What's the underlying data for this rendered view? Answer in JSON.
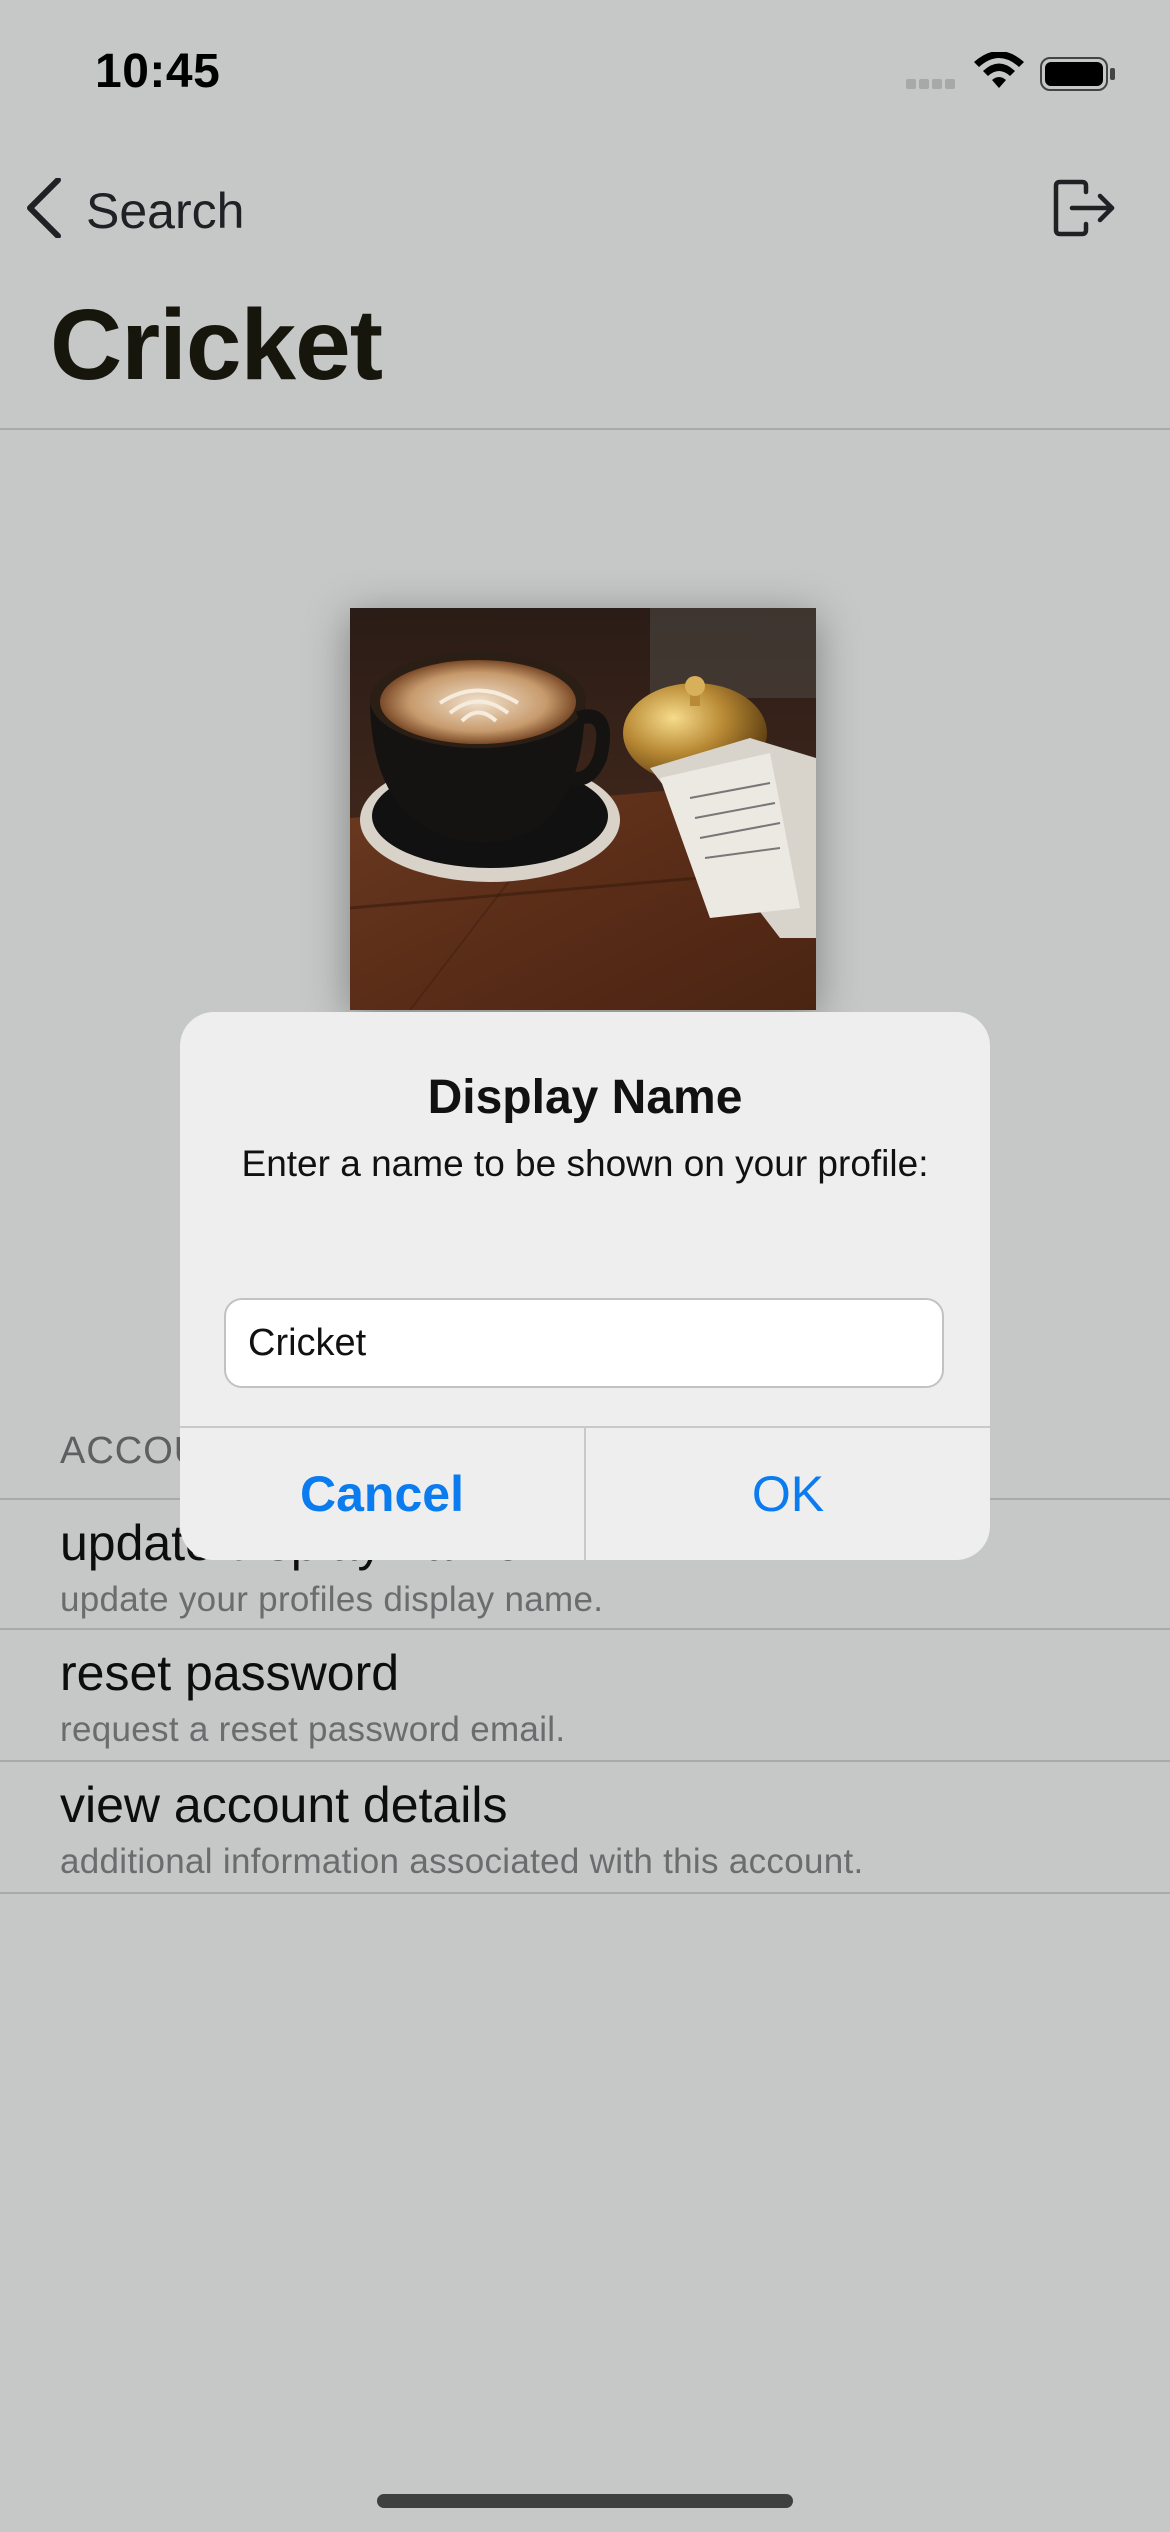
{
  "status_bar": {
    "time": "10:45",
    "icons": [
      "cellular-icon",
      "wifi-icon",
      "battery-icon"
    ]
  },
  "nav": {
    "back_label": "Search",
    "back_icon": "chevron-left-icon",
    "action_icon": "logout-icon",
    "title": "Cricket"
  },
  "profile": {
    "photo": "latte-and-desk-bell-photo"
  },
  "account_section": {
    "header": "ACCOU",
    "rows": [
      {
        "title": "update display name",
        "subtitle": "update your profiles display name."
      },
      {
        "title": "reset password",
        "subtitle": "request a reset password email."
      },
      {
        "title": "view account details",
        "subtitle": "additional information associated with this account."
      }
    ]
  },
  "alert": {
    "title": "Display Name",
    "message": "Enter a name to be shown on your profile:",
    "input_value": "Cricket",
    "cancel_label": "Cancel",
    "ok_label": "OK"
  },
  "colors": {
    "accent": "#0a7cf0",
    "background": "#c6c7c7",
    "alert_background": "#eeeeee"
  }
}
